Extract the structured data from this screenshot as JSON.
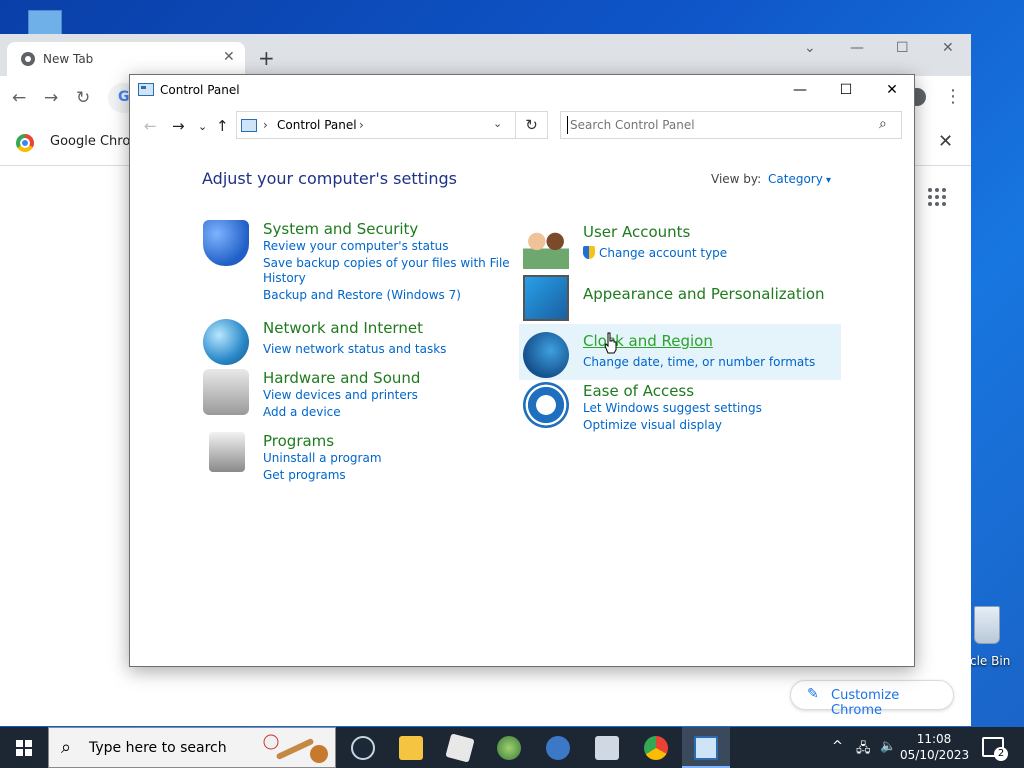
{
  "desktop": {
    "recycle_bin_label": "cle Bin"
  },
  "chrome": {
    "tab_title": "New Tab",
    "tab_close": "✕",
    "new_tab": "+",
    "infobar_text": "Google Chron",
    "infobar_close": "✕",
    "customize_label": "Customize Chrome"
  },
  "control_panel": {
    "window_title": "Control Panel",
    "address_crumb": "Control Panel",
    "search_placeholder": "Search Control Panel",
    "heading": "Adjust your computer's settings",
    "view_by_label": "View by:",
    "view_by_value": "Category",
    "categories_left": [
      {
        "title": "System and Security",
        "links": [
          "Review your computer's status",
          "Save backup copies of your files with File",
          "History",
          "Backup and Restore (Windows 7)"
        ]
      },
      {
        "title": "Network and Internet",
        "links": [
          "View network status and tasks"
        ]
      },
      {
        "title": "Hardware and Sound",
        "links": [
          "View devices and printers",
          "Add a device"
        ]
      },
      {
        "title": "Programs",
        "links": [
          "Uninstall a program",
          "Get programs"
        ]
      }
    ],
    "categories_right": [
      {
        "title": "User Accounts",
        "links": [
          "Change account type"
        ]
      },
      {
        "title": "Appearance and Personalization",
        "links": []
      },
      {
        "title": "Clock and Region",
        "links": [
          "Change date, time, or number formats"
        ]
      },
      {
        "title": "Ease of Access",
        "links": [
          "Let Windows suggest settings",
          "Optimize visual display"
        ]
      }
    ]
  },
  "taskbar": {
    "search_placeholder": "Type here to search",
    "time": "11:08",
    "date": "05/10/2023",
    "notification_count": "2"
  },
  "colors": {
    "category_title": "#1e7b1e",
    "link": "#0066cc",
    "heading": "#1e3287",
    "hover_bg": "#e5f3fb"
  }
}
